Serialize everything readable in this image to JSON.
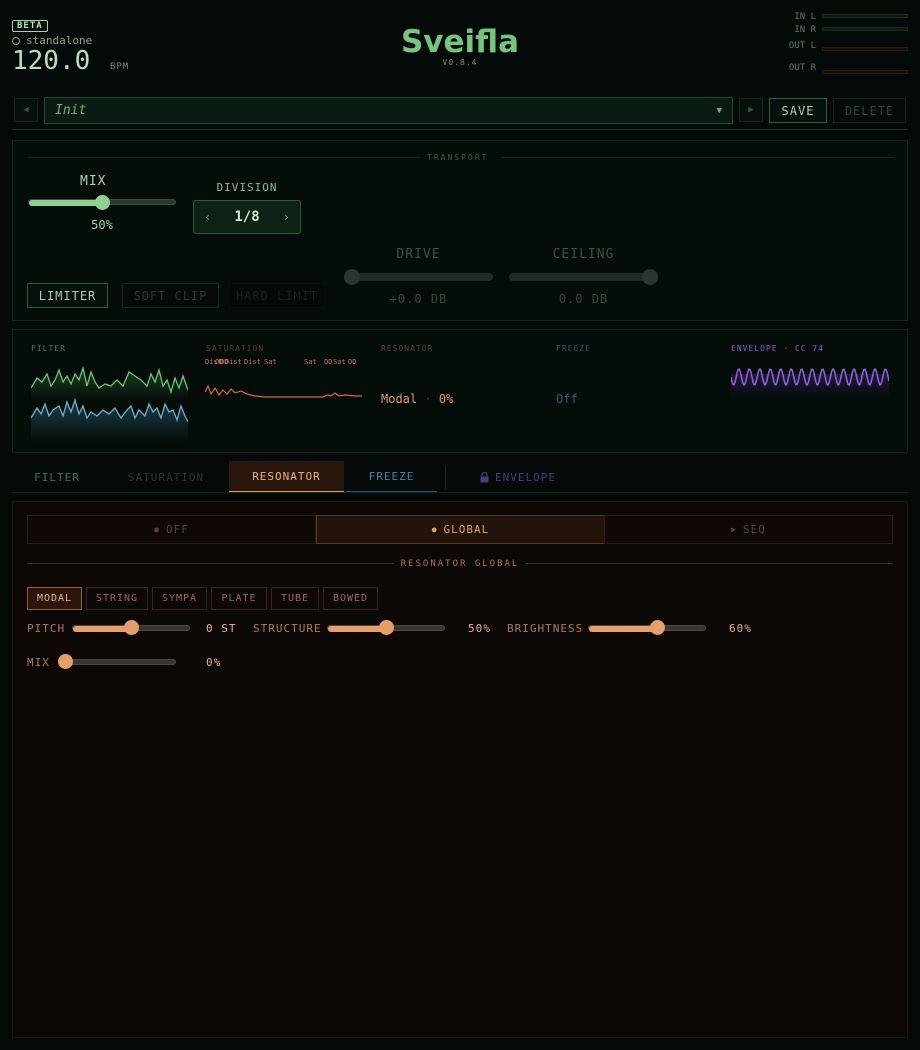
{
  "header": {
    "badge": "BETA",
    "mode": "standalone",
    "bpm": "120.0",
    "bpm_unit": "BPM",
    "title": "Sveifla",
    "version": "V0.8.4",
    "meters": [
      {
        "label": "IN L",
        "type": "in"
      },
      {
        "label": "IN R",
        "type": "in"
      },
      {
        "label": "OUT L",
        "type": "out"
      },
      {
        "label": "OUT R",
        "type": "out"
      }
    ]
  },
  "preset": {
    "prev_icon": "◀",
    "next_icon": "▶",
    "name": "Init",
    "caret": "▼",
    "save_label": "SAVE",
    "delete_label": "DELETE"
  },
  "transport": {
    "title": "TRANSPORT",
    "mix_label": "MIX",
    "mix_value": "50%",
    "mix_level": 0.5,
    "division_label": "DIVISION",
    "division_value": "1/8",
    "division_prev": "‹",
    "division_next": "›",
    "drive_label": "DRIVE",
    "drive_value": "+0.0 DB",
    "drive_level": 0.0,
    "ceiling_label": "CEILING",
    "ceiling_value": "0.0 DB",
    "ceiling_level": 1.0,
    "clip_modes": [
      "LIMITER",
      "SOFT CLIP",
      "HARD LIMIT"
    ]
  },
  "overview": {
    "filter_title": "FILTER",
    "saturation_title": "SATURATION",
    "saturation_tags": [
      "Dist",
      "OD",
      "OD",
      "Dist",
      "Dist",
      "Sat",
      "Sat",
      "OD",
      "Sat",
      "OD"
    ],
    "resonator_title": "RESONATOR",
    "resonator_mode": "Modal",
    "resonator_sep": "·",
    "resonator_amount": "0%",
    "freeze_title": "FREEZE",
    "freeze_state": "Off",
    "envelope_title": "ENVELOPE · CC 74"
  },
  "tabs": [
    {
      "label": "FILTER"
    },
    {
      "label": "SATURATION"
    },
    {
      "label": "RESONATOR"
    },
    {
      "label": "FREEZE"
    },
    {
      "label": "ENVELOPE"
    }
  ],
  "resonator": {
    "modes": [
      {
        "icon": "●",
        "label": "OFF"
      },
      {
        "icon": "●",
        "label": "GLOBAL"
      },
      {
        "icon": "▶",
        "label": "SEQ"
      }
    ],
    "section_title": "RESONATOR GLOBAL",
    "types": [
      "MODAL",
      "STRING",
      "SYMPA",
      "PLATE",
      "TUBE",
      "BOWED"
    ],
    "params": {
      "pitch": {
        "label": "PITCH",
        "value": "0 ST",
        "level": 0.5
      },
      "structure": {
        "label": "STRUCTURE",
        "value": "50%",
        "level": 0.5
      },
      "brightness": {
        "label": "BRIGHTNESS",
        "value": "60%",
        "level": 0.6
      },
      "mix": {
        "label": "MIX",
        "value": "0%",
        "level": 0.0
      }
    }
  },
  "colors": {
    "accent_green": "#8fd190",
    "resonator_orange": "#e5a068",
    "freeze_blue": "#3f6f9e",
    "envelope_purple": "#8a5fd6",
    "saturation_red": "#d8674a"
  }
}
